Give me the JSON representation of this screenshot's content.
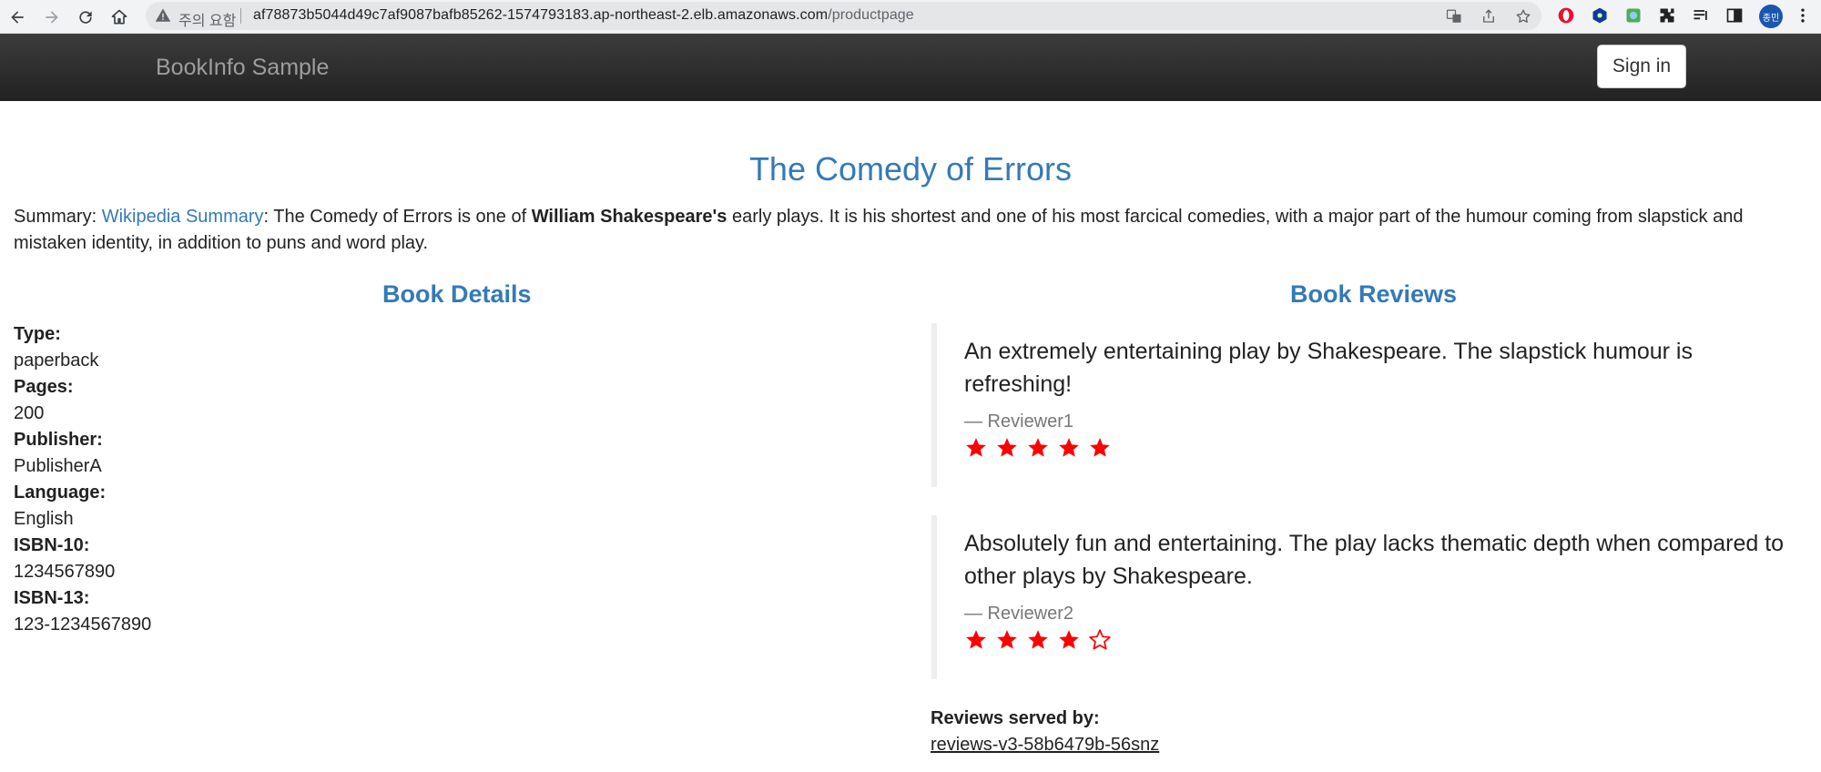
{
  "browser": {
    "security_text": "주의 요함",
    "url_host": "af78873b5044d49c7af9087bafb85262-1574793183.ap-northeast-2.elb.amazonaws.com",
    "url_path": "/productpage",
    "avatar_text": "종민"
  },
  "navbar": {
    "brand": "BookInfo Sample",
    "signin_label": "Sign in"
  },
  "product": {
    "title": "The Comedy of Errors",
    "summary_prefix": "Summary: ",
    "summary_link": "Wikipedia Summary",
    "summary_text1": ": The Comedy of Errors is one of ",
    "summary_bold": "William Shakespeare's",
    "summary_text2": " early plays. It is his shortest and one of his most farcical comedies, with a major part of the humour coming from slapstick and mistaken identity, in addition to puns and word play."
  },
  "details": {
    "heading": "Book Details",
    "fields": [
      {
        "label": "Type:",
        "value": "paperback"
      },
      {
        "label": "Pages:",
        "value": "200"
      },
      {
        "label": "Publisher:",
        "value": "PublisherA"
      },
      {
        "label": "Language:",
        "value": "English"
      },
      {
        "label": "ISBN-10:",
        "value": "1234567890"
      },
      {
        "label": "ISBN-13:",
        "value": "123-1234567890"
      }
    ]
  },
  "reviews": {
    "heading": "Book Reviews",
    "items": [
      {
        "text": "An extremely entertaining play by Shakespeare. The slapstick humour is refreshing!",
        "reviewer": "— Reviewer1",
        "rating": 5,
        "max": 5
      },
      {
        "text": "Absolutely fun and entertaining. The play lacks thematic depth when compared to other plays by Shakespeare.",
        "reviewer": "— Reviewer2",
        "rating": 4,
        "max": 5
      }
    ],
    "served_label": "Reviews served by:",
    "served_value": "reviews-v3-58b6479b-56snz",
    "star_color": "#ff0000"
  },
  "colors": {
    "accent": "#337ab7",
    "navbar": "#222222"
  }
}
